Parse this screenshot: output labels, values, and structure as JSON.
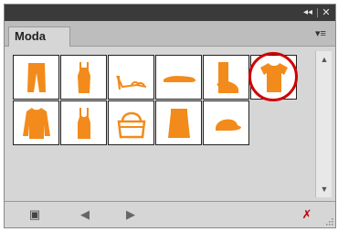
{
  "panel": {
    "titlebar": {
      "collapse_icon": "double-chevron-left-icon",
      "collapse_glyph": "◂◂",
      "close_icon": "close-icon",
      "close_glyph": "✕"
    },
    "tab": {
      "label": "Moda"
    },
    "menu_glyph": "▾≡",
    "shapes": [
      {
        "name": "pants"
      },
      {
        "name": "tank-dress"
      },
      {
        "name": "high-heel-sandal"
      },
      {
        "name": "flat-shoe"
      },
      {
        "name": "boot"
      },
      {
        "name": "t-shirt",
        "selected": true
      },
      {
        "name": "sweater"
      },
      {
        "name": "tank-top"
      },
      {
        "name": "handbag"
      },
      {
        "name": "skirt"
      },
      {
        "name": "cap"
      }
    ],
    "accent_color": "#f28b1b",
    "highlight_color": "#d00000",
    "scrollbar": {
      "up_glyph": "▲",
      "down_glyph": "▼"
    },
    "bottombar": {
      "library_glyph": "▣",
      "prev_glyph": "◀",
      "next_glyph": "▶",
      "delete_glyph": "✗"
    }
  }
}
